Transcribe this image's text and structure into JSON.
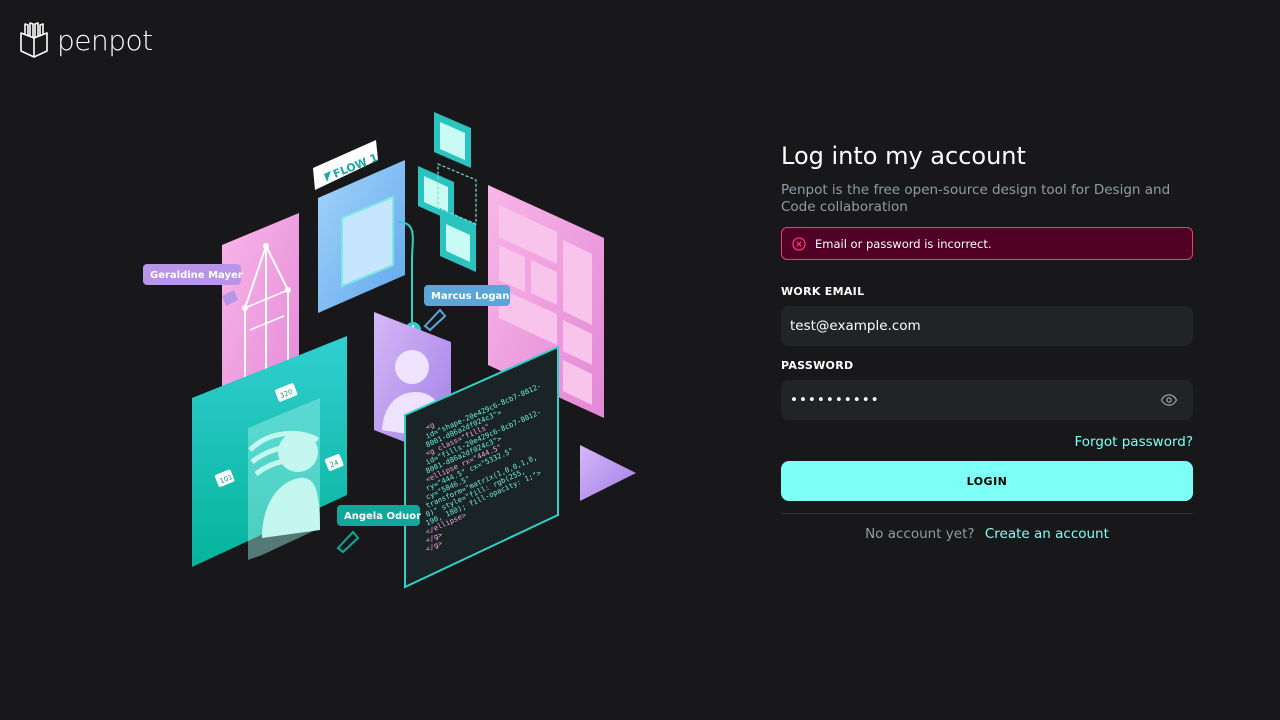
{
  "brand": {
    "name": "penpot",
    "accent": "#7efff5",
    "error_border": "#ff3277",
    "error_bg": "#500124"
  },
  "illustration": {
    "flow_tag": "FLOW 1",
    "user_tags": [
      "Geraldine Mayer",
      "Marcus Logan",
      "Angela Oduor"
    ],
    "code_lines": [
      "<g",
      "id=\"shape-20e429c6-8cb7-8012-",
      "8001-d86a2df024c3\">",
      "<g class=\"fills\"",
      "id=\"fills-20e429c6-8cb7-8012-",
      "8001-d86a2df024c3\">",
      "<ellipse rx=\"444.5\"",
      "ry=\"444.5\" cx=\"5332.5\"",
      "cy=\"5846.5\"",
      "transform=\"matrix(1,0,0,1,0,",
      "0)\" style=\"fill: rgb(255,",
      "190, 180); fill-opacity: 1;\">",
      "</ellipse>",
      "</g>",
      "</g>"
    ],
    "dimension_labels": [
      "320",
      "101",
      "24"
    ]
  },
  "login": {
    "title": "Log into my account",
    "subtitle": "Penpot is the free open-source design tool for Design and Code collaboration",
    "error_message": "Email or password is incorrect.",
    "email_label": "WORK EMAIL",
    "email_value": "test@example.com",
    "password_label": "PASSWORD",
    "password_value": "••••••••••",
    "forgot_password": "Forgot password?",
    "login_button": "LOGIN",
    "no_account_text": "No account yet?",
    "create_account": "Create an account"
  }
}
